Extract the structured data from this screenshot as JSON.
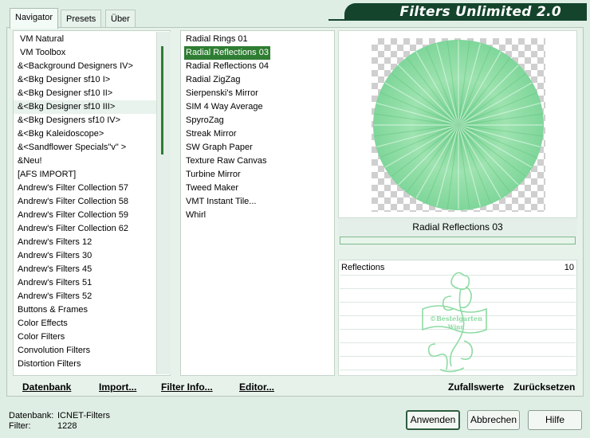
{
  "tabs": [
    "Navigator",
    "Presets",
    "Über"
  ],
  "app_title": "Filters Unlimited 2.0",
  "categories": [
    "VM Natural",
    "VM Toolbox",
    "&<Background Designers IV>",
    "&<Bkg Designer sf10 I>",
    "&<Bkg Designer sf10 II>",
    "&<Bkg Designer sf10 III>",
    "&<Bkg Designers sf10 IV>",
    "&<Bkg Kaleidoscope>",
    "&<Sandflower Specials\"v\" >",
    "&Neu!",
    "[AFS IMPORT]",
    "Andrew's Filter Collection 57",
    "Andrew's Filter Collection 58",
    "Andrew's Filter Collection 59",
    "Andrew's Filter Collection 62",
    "Andrew's Filters 12",
    "Andrew's Filters 30",
    "Andrew's Filters 45",
    "Andrew's Filters 51",
    "Andrew's Filters 52",
    "Buttons & Frames",
    "Color Effects",
    "Color Filters",
    "Convolution Filters",
    "Distortion Filters"
  ],
  "categories_selected_index": 5,
  "filters": [
    "Radial  Rings 01",
    "Radial Reflections 03",
    "Radial Reflections 04",
    "Radial ZigZag",
    "Sierpenski's Mirror",
    "SIM 4 Way Average",
    "SpyroZag",
    "Streak Mirror",
    "SW Graph Paper",
    "Texture Raw Canvas",
    "Turbine Mirror",
    "Tweed Maker",
    "VMT Instant Tile...",
    "Whirl"
  ],
  "filters_selected_index": 1,
  "left_actions": {
    "database": "Datenbank",
    "import": "Import...",
    "filter_info": "Filter Info...",
    "editor": "Editor..."
  },
  "selected_filter_name": "Radial Reflections 03",
  "param": {
    "label": "Reflections",
    "value": "10"
  },
  "watermark": "©Bestelgarten Winn",
  "right_actions": {
    "random": "Zufallswerte",
    "reset": "Zurücksetzen"
  },
  "status": {
    "db_label": "Datenbank:",
    "db_value": "ICNET-Filters",
    "filter_label": "Filter:",
    "filter_value": "1228"
  },
  "buttons": {
    "apply": "Anwenden",
    "cancel": "Abbrechen",
    "help": "Hilfe"
  },
  "colors": {
    "accent": "#2e7d32",
    "banner": "#14442c",
    "preview_green": "#8edba4"
  }
}
